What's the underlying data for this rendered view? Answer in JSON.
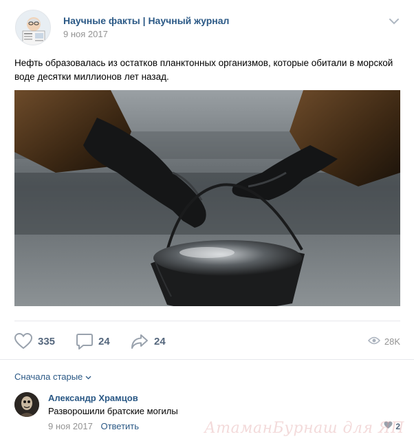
{
  "post": {
    "author": "Научные факты | Научный журнал",
    "date": "9 ноя 2017",
    "text": "Нефть образовалась из остатков планктонных организмов, которые обитали в морской воде десятки миллионов лет назад.",
    "image_icon": "oil-bucket-photo"
  },
  "actions": {
    "likes": "335",
    "comments": "24",
    "shares": "24",
    "views": "28K"
  },
  "comments": {
    "sort_label": "Сначала старые",
    "items": [
      {
        "author": "Александр Храмцов",
        "text": "Разворошили братские могилы",
        "date": "9 ноя 2017",
        "reply_label": "Ответить",
        "likes": "2"
      }
    ]
  },
  "watermark": "АтаманБурнаш для ЯП",
  "colors": {
    "link": "#2a5885",
    "muted": "#939393",
    "icon": "#99a2ad"
  }
}
